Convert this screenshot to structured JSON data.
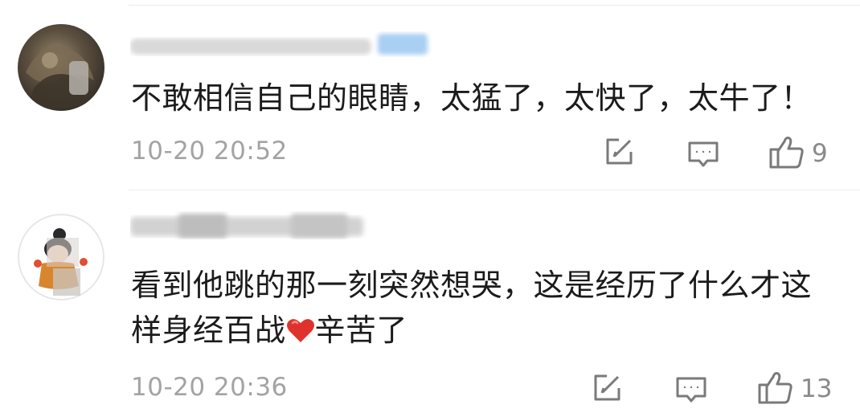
{
  "comments": [
    {
      "text": "不敢相信自己的眼睛，太猛了，太快了，太牛了！",
      "timestamp": "10-20 20:52",
      "likes": "9"
    },
    {
      "text_before_emoji": "看到他跳的那一刻突然想哭，这是经历了什么才这样身经百战",
      "emoji": "heart",
      "text_after_emoji": "辛苦了",
      "timestamp": "10-20 20:36",
      "likes": "13"
    }
  ],
  "icons": {
    "edit": "edit-icon",
    "reply": "comment-icon",
    "like": "thumbs-up-icon"
  },
  "colors": {
    "text": "#1b1b1b",
    "meta": "#a3a3a3",
    "divider": "#ececec",
    "heart": "#e0322d",
    "badge": "#a9cff2"
  }
}
